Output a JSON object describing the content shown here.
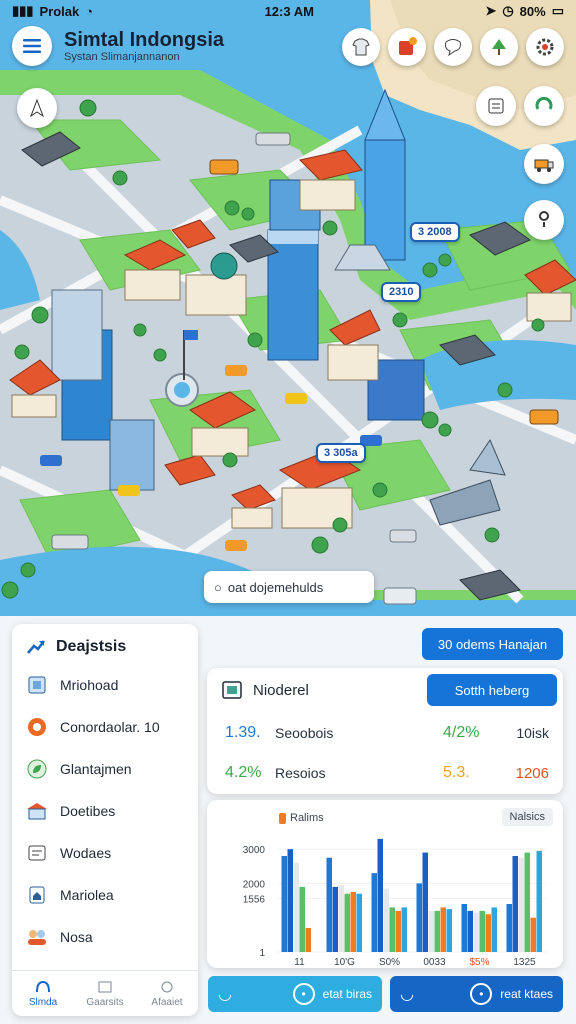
{
  "status_bar": {
    "carrier": "Prolak",
    "time": "12:3 AM",
    "battery": "80%"
  },
  "header": {
    "title": "Simtal Indongsia",
    "subtitle": "Systan Slimanjannanon"
  },
  "map": {
    "pins": [
      "3 2008",
      "2310",
      "3 305a"
    ],
    "search_text": "oat dojemehulds"
  },
  "side_panel": {
    "title": "Deajstsis",
    "items": [
      {
        "label": "Mriohoad",
        "icon": "document-icon"
      },
      {
        "label": "Conordaolar. 10",
        "icon": "orange-badge-icon"
      },
      {
        "label": "Glantajmen",
        "icon": "leaf-icon"
      },
      {
        "label": "Doetibes",
        "icon": "building-icon"
      },
      {
        "label": "Wodaes",
        "icon": "card-icon"
      },
      {
        "label": "Mariolea",
        "icon": "house-icon"
      },
      {
        "label": "Nosa",
        "icon": "people-icon"
      }
    ],
    "tabs": [
      {
        "label": "Slmda"
      },
      {
        "label": "Gaarsits"
      },
      {
        "label": "Afaaiet"
      }
    ]
  },
  "top_button_label": "30 odems Hanajan",
  "stats_card": {
    "title": "Nioderel",
    "button": "Sotth heberg",
    "rows": [
      {
        "value": "1.39.",
        "label": "Seoobois",
        "change": "4/2%",
        "extra": "10isk"
      },
      {
        "value": "4.2%",
        "label": "Resoios",
        "change": "5.3.",
        "extra": "1206"
      }
    ]
  },
  "chart_data": {
    "type": "bar",
    "legend": "Ralims",
    "badge": "Nalsics",
    "yticks": [
      "3000",
      "2000",
      "1556",
      "1"
    ],
    "categories": [
      "11",
      "10'G",
      "S0%",
      "0033",
      "$5%",
      "1325"
    ],
    "ylim": [
      0,
      3500
    ],
    "series": [
      {
        "values": [
          2800,
          2750,
          2300,
          2000,
          1400,
          1400
        ],
        "color": "#1e78d6"
      },
      {
        "values": [
          3000,
          1900,
          3300,
          2900,
          1200,
          2800
        ],
        "color": "#1a5fc4"
      },
      {
        "values": [
          2600,
          1950,
          1850,
          1200,
          1150,
          2750
        ],
        "color": "#e5e9ed"
      },
      {
        "values": [
          1900,
          1700,
          1300,
          1200,
          1200,
          2900
        ],
        "color": "#5bbf6a"
      },
      {
        "values": [
          700,
          1750,
          1200,
          1300,
          1100,
          1000
        ],
        "color": "#f07b22"
      },
      {
        "values": [
          0,
          1700,
          1300,
          1250,
          1300,
          2950
        ],
        "color": "#2fa5e0"
      }
    ],
    "colors": {
      "orange": "#f07b22",
      "green": "#5bbf6a",
      "blue": "#1e78d6"
    }
  },
  "bottom_buttons": [
    {
      "label": "etat biras"
    },
    {
      "label": "reat ktaes"
    }
  ]
}
